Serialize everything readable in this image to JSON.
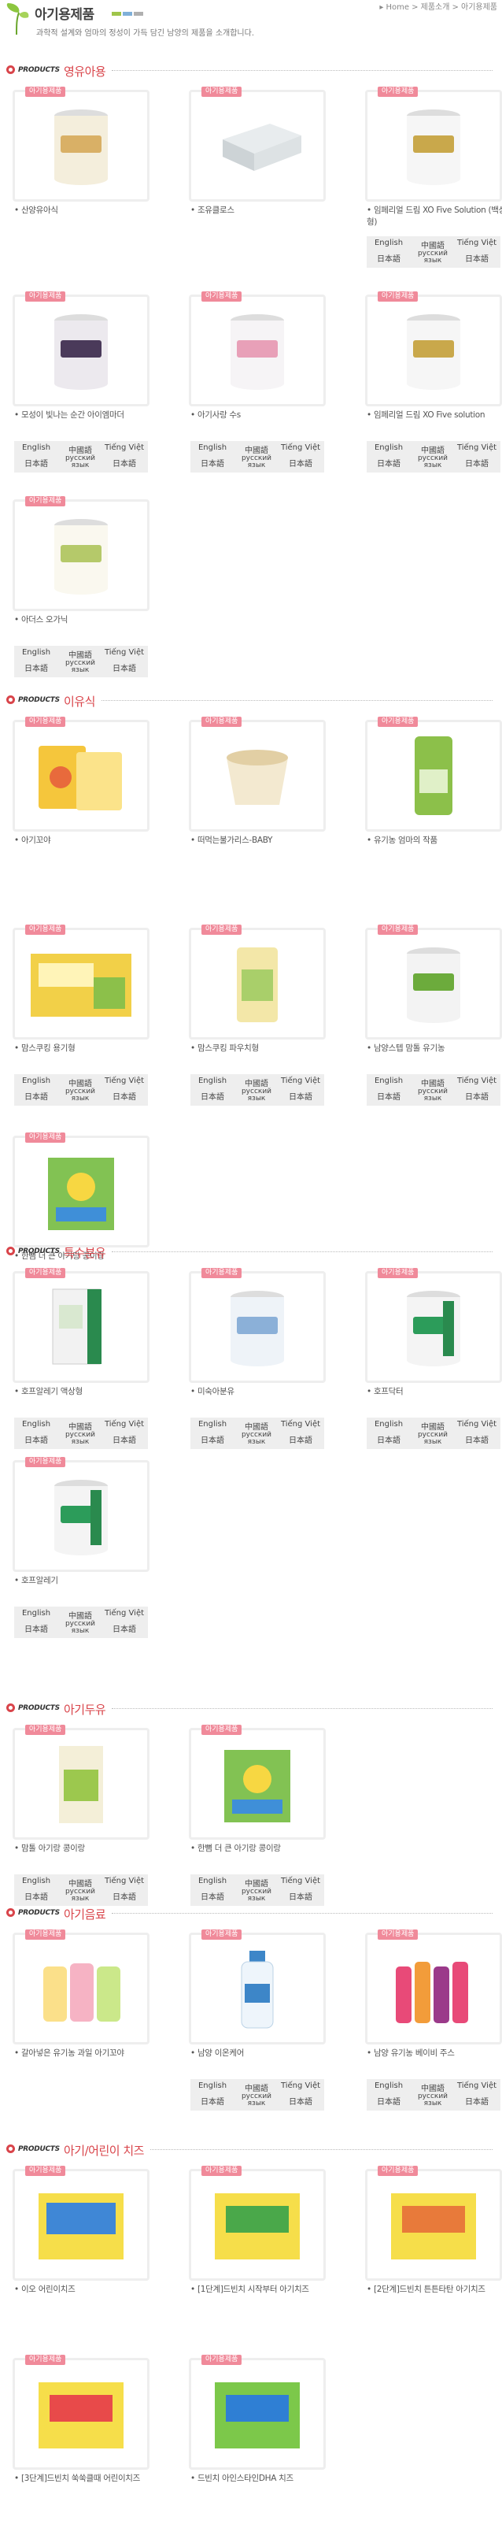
{
  "header": {
    "title": "아기용제품",
    "desc": "과학적 설계와 엄마의 정성이 가득 담긴 남양의 제품을 소개합니다.",
    "crumb": [
      "▸ Home",
      "> 제품소개",
      "> 아기용제품"
    ]
  },
  "colors": {
    "accent": "#d9444a",
    "tag": "#f08a9a",
    "bar": [
      "#9fc54a",
      "#7fb0d8",
      "#b0b0b0"
    ]
  },
  "tag_label": "아기용제품",
  "lang_labels": [
    "English",
    "中國語",
    "Tiếng Việt",
    "日本語",
    "русский язык",
    "日本語"
  ],
  "sections": [
    {
      "prod": "PRODUCTS",
      "name": "영유아용",
      "items": [
        {
          "name": "산양유아식",
          "img": "can-white",
          "lang": false
        },
        {
          "name": "조유클로스",
          "img": "box",
          "lang": false
        },
        {
          "name": "임페리얼 드림 XO Five Solution (백상형)",
          "img": "can-gold",
          "lang": true
        },
        {
          "name": "모성이 빛나는 순간 아이엠마더",
          "img": "can-dark",
          "lang": true
        },
        {
          "name": "아기사랑 수s",
          "img": "can-pink",
          "lang": true
        },
        {
          "name": "임페리얼 드림 XO Five solution",
          "img": "can-gold",
          "lang": true
        },
        {
          "name": "아더스 오가닉",
          "img": "can-organic",
          "lang": true
        }
      ]
    },
    {
      "prod": "PRODUCTS",
      "name": "이유식",
      "items": [
        {
          "name": "아기꼬야",
          "img": "snack",
          "lang": false
        },
        {
          "name": "떠먹는불가리스-BABY",
          "img": "cup",
          "lang": false
        },
        {
          "name": "유기농 엄마의 작품",
          "img": "pouch-green",
          "lang": false
        },
        {
          "name": "맘스쿠킹 용기형",
          "img": "box-yellow",
          "lang": true
        },
        {
          "name": "맘스쿠킹 파우치형",
          "img": "pouch-yellow",
          "lang": true
        },
        {
          "name": "남양스텝 맘톨 유기농",
          "img": "can-leaf",
          "lang": true
        },
        {
          "name": "한뼘 더 큰 아기랑 콩이랑",
          "img": "box-green",
          "lang": true
        }
      ]
    },
    {
      "prod": "PRODUCTS",
      "name": "특수분유",
      "items": [
        {
          "name": "호프알레기 액상형",
          "img": "hope-box",
          "lang": true
        },
        {
          "name": "미숙아분유",
          "img": "can-blue",
          "lang": true
        },
        {
          "name": "호프닥터",
          "img": "hope-can",
          "lang": true
        },
        {
          "name": "호프알레기",
          "img": "hope-can",
          "lang": true
        }
      ]
    },
    {
      "prod": "PRODUCTS",
      "name": "아기두유",
      "items": [
        {
          "name": "맘톨 아기랑 콩이랑",
          "img": "pack",
          "lang": true
        },
        {
          "name": "한뼘 더 큰 아기랑 콩이랑",
          "img": "box-green",
          "lang": true
        }
      ]
    },
    {
      "prod": "PRODUCTS",
      "name": "아기음료",
      "items": [
        {
          "name": "갈아넣은 유기농 과일 아기꼬야",
          "img": "pouches",
          "lang": false
        },
        {
          "name": "남양 이온케어",
          "img": "bottle",
          "lang": true
        },
        {
          "name": "남양 유기농 베이비 주스",
          "img": "bottles",
          "lang": true
        }
      ]
    },
    {
      "prod": "PRODUCTS",
      "name": "아기/어린이 치즈",
      "items": [
        {
          "name": "이오 어린이치즈",
          "img": "cheese-blue",
          "lang": false
        },
        {
          "name": "[1단계]드빈치 시작부터 아기치즈",
          "img": "cheese-yellow",
          "lang": false
        },
        {
          "name": "[2단계]드빈치 튼튼타탄 아기치즈",
          "img": "cheese-yellow2",
          "lang": false
        },
        {
          "name": "[3단계]드빈치 쑥쑥클때 어린이치즈",
          "img": "cheese-yellow3",
          "lang": false
        },
        {
          "name": "드빈치 아인스타인DHA 치즈",
          "img": "cheese-green",
          "lang": false
        }
      ]
    }
  ]
}
